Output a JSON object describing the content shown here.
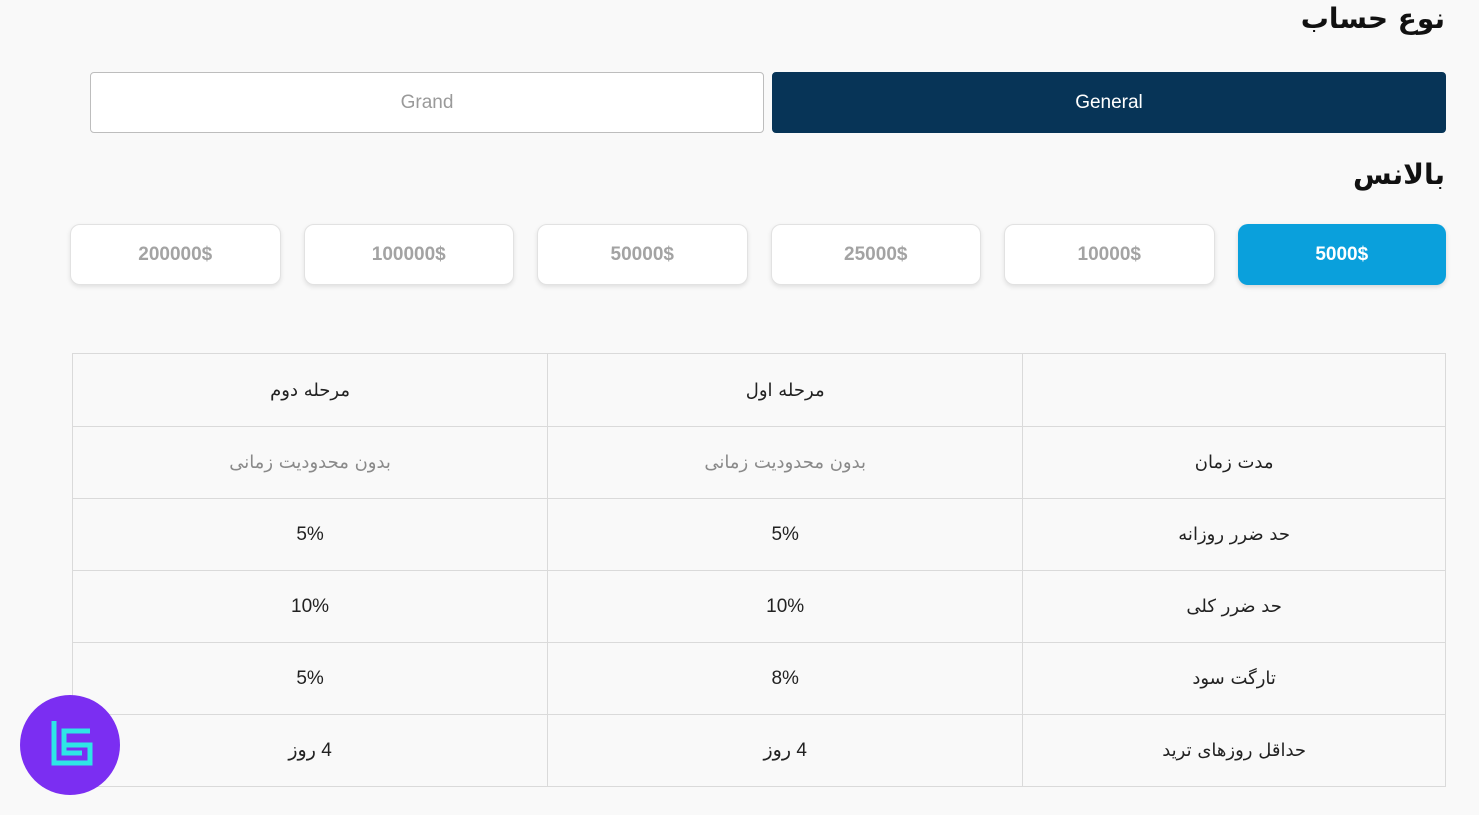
{
  "account_type": {
    "title": "نوع حساب",
    "options": [
      {
        "label": "General",
        "active": true
      },
      {
        "label": "Grand",
        "active": false
      }
    ]
  },
  "balance": {
    "title": "بالانس",
    "options": [
      {
        "label": "5000$",
        "active": true
      },
      {
        "label": "10000$",
        "active": false
      },
      {
        "label": "25000$",
        "active": false
      },
      {
        "label": "50000$",
        "active": false
      },
      {
        "label": "100000$",
        "active": false
      },
      {
        "label": "200000$",
        "active": false
      }
    ]
  },
  "table": {
    "headers": [
      "",
      "مرحله اول",
      "مرحله دوم"
    ],
    "rows": [
      {
        "label": "مدت زمان",
        "phase1": "بدون محدودیت زمانی",
        "phase2": "بدون محدودیت زمانی"
      },
      {
        "label": "حد ضرر روزانه",
        "phase1": "5%",
        "phase2": "5%"
      },
      {
        "label": "حد ضرر کلی",
        "phase1": "10%",
        "phase2": "10%"
      },
      {
        "label": "تارگت سود",
        "phase1": "8%",
        "phase2": "5%"
      },
      {
        "label": "حداقل روزهای ترید",
        "phase1": "4 روز",
        "phase2": "4 روز"
      }
    ]
  },
  "colors": {
    "account_active": "#073457",
    "balance_active": "#0aa0dc",
    "logo_bg": "#7b2ef2",
    "logo_fg": "#2ee6e6"
  },
  "logo": {
    "icon": "tradingfinder-logo-icon"
  }
}
